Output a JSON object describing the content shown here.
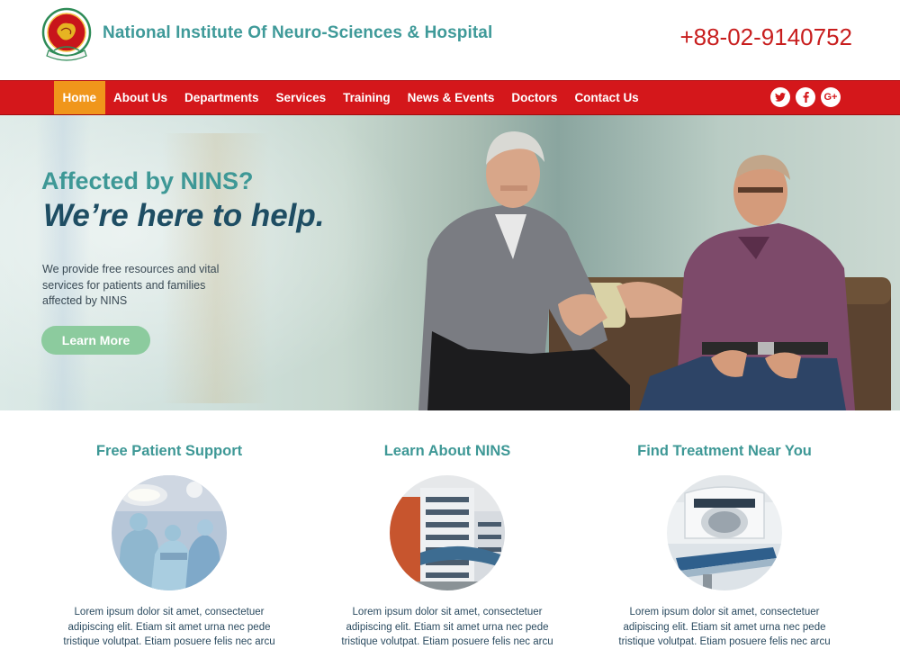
{
  "header": {
    "site_title": "National Institute Of Neuro-Sciences & Hospital",
    "phone": "+88-02-9140752"
  },
  "nav": {
    "items": [
      {
        "label": "Home",
        "active": true
      },
      {
        "label": "About Us"
      },
      {
        "label": "Departments"
      },
      {
        "label": "Services"
      },
      {
        "label": "Training"
      },
      {
        "label": "News & Events"
      },
      {
        "label": "Doctors"
      },
      {
        "label": "Contact Us"
      }
    ],
    "social": [
      "twitter-icon",
      "facebook-icon",
      "google-plus-icon"
    ],
    "social_glyphs": [
      "t",
      "f",
      "G+"
    ]
  },
  "hero": {
    "kicker": "Affected by NINS?",
    "title": "We’re here to help.",
    "description": "We provide free resources and vital services for patients and families affected by NINS",
    "button_label": "Learn More"
  },
  "features": [
    {
      "title": "Free Patient Support",
      "image": "surgery-team-photo",
      "text": "Lorem ipsum dolor sit amet, consectetuer adipiscing elit. Etiam sit amet urna nec pede tristique volutpat. Etiam posuere felis nec arcu"
    },
    {
      "title": "Learn About NINS",
      "image": "hospital-building-photo",
      "text": "Lorem ipsum dolor sit amet, consectetuer adipiscing elit. Etiam sit amet urna nec pede tristique volutpat. Etiam posuere felis nec arcu"
    },
    {
      "title": "Find Treatment Near You",
      "image": "mri-scanner-photo",
      "text": "Lorem ipsum dolor sit amet, consectetuer adipiscing elit. Etiam sit amet urna nec pede tristique volutpat. Etiam posuere felis nec arcu"
    }
  ],
  "colors": {
    "brand_teal": "#3e9896",
    "nav_red": "#d4171b",
    "nav_active": "#f0961b",
    "phone_red": "#c81e1e",
    "button_green": "#8ccb9e"
  }
}
